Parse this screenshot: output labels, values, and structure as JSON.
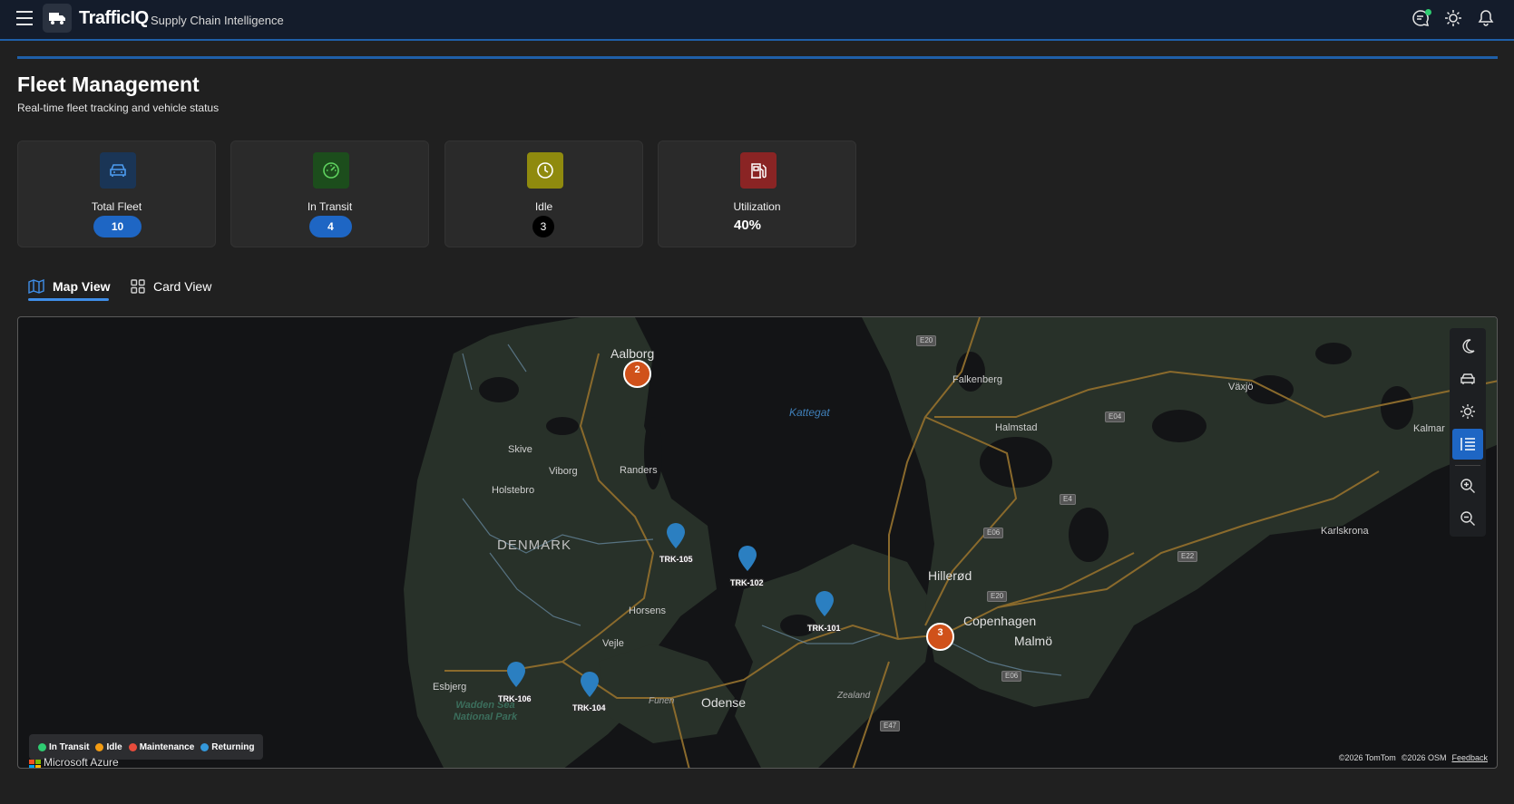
{
  "header": {
    "brand": "TrafficIQ",
    "brand_sub": "Supply Chain Intelligence",
    "icons": [
      "menu-icon",
      "truck-icon",
      "chat-icon",
      "sun-icon",
      "bell-icon"
    ],
    "accent_color": "#1f5fa8"
  },
  "page": {
    "title": "Fleet Management",
    "subtitle": "Real-time fleet tracking and vehicle status"
  },
  "stats": [
    {
      "label": "Total Fleet",
      "value": "10",
      "icon": "car-icon",
      "color": "#1e66c4"
    },
    {
      "label": "In Transit",
      "value": "4",
      "icon": "speedometer-icon",
      "color": "#1e66c4"
    },
    {
      "label": "Idle",
      "value": "3",
      "icon": "clock-icon",
      "color": "#000000"
    },
    {
      "label": "Utilization",
      "value": "40%",
      "icon": "fuel-icon",
      "color": "#9a2626"
    }
  ],
  "tabs": [
    {
      "label": "Map View",
      "active": true
    },
    {
      "label": "Card View",
      "active": false
    }
  ],
  "map": {
    "places": {
      "aalborg": "Aalborg",
      "skive": "Skive",
      "viborg": "Viborg",
      "randers": "Randers",
      "holstebro": "Holstebro",
      "denmark": "DENMARK",
      "horsens": "Horsens",
      "vejle": "Vejle",
      "esbjerg": "Esbjerg",
      "funen": "Funen",
      "odense": "Odense",
      "zealand": "Zealand",
      "hillerod": "Hillerød",
      "copenhagen": "Copenhagen",
      "malmo": "Malmö",
      "falkenberg": "Falkenberg",
      "halmstad": "Halmstad",
      "vaxjo": "Växjö",
      "karlskrona": "Karlskrona",
      "kalmar": "Kalmar",
      "kattegat": "Kattegat",
      "wadden": "Wadden Sea National Park"
    },
    "highways": {
      "e20a": "E20",
      "e04": "E04",
      "e4": "E4",
      "e06a": "E06",
      "e22": "E22",
      "e20b": "E20",
      "e06b": "E06",
      "e47": "E47"
    },
    "clusters": [
      {
        "count": "2",
        "color": "#d0511a"
      },
      {
        "count": "3",
        "color": "#d0511a"
      }
    ],
    "vehicles": [
      {
        "id": "TRK-105",
        "status": "Returning"
      },
      {
        "id": "TRK-102",
        "status": "Returning"
      },
      {
        "id": "TRK-101",
        "status": "Returning"
      },
      {
        "id": "TRK-106",
        "status": "Returning"
      },
      {
        "id": "TRK-104",
        "status": "Returning"
      }
    ],
    "legend": [
      {
        "label": "In Transit",
        "color": "#2ecc71"
      },
      {
        "label": "Idle",
        "color": "#f39c12"
      },
      {
        "label": "Maintenance",
        "color": "#e74c3c"
      },
      {
        "label": "Returning",
        "color": "#3498db"
      }
    ],
    "controls": [
      "moon-icon",
      "car-icon",
      "sun-icon",
      "list-icon",
      "zoom-in-icon",
      "zoom-out-icon"
    ],
    "branding": "Microsoft Azure",
    "attribution": [
      "©2026 TomTom",
      "©2026 OSM"
    ],
    "feedback": "Feedback"
  }
}
